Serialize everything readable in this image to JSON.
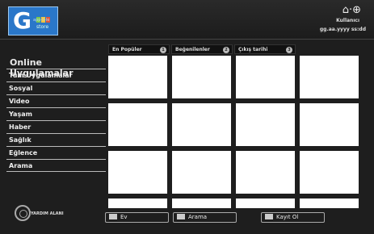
{
  "header": {
    "logo_letter": "G",
    "logo_line1": "app-li-le",
    "logo_line2": "store",
    "top_icons": "⌂·⊕",
    "user_label": "Kullanıcı",
    "datetime": "gg.aa.yyyy ss:dd"
  },
  "sidebar": {
    "title": "Online Uygulamalar",
    "items": [
      "Tüm Uygulamalar",
      "Sosyal",
      "Video",
      "Yaşam",
      "Haber",
      "Sağlık",
      "Eğlence",
      "Arama"
    ]
  },
  "tabs": [
    {
      "label": "En Popüler",
      "num": "1"
    },
    {
      "label": "Beğenilenler",
      "num": "2"
    },
    {
      "label": "Çıkış tarihi",
      "num": "3"
    }
  ],
  "help_label": "YARDIM ALANI",
  "bottom_buttons": [
    "Ev",
    "Arama",
    "Kayıt Ol"
  ],
  "colors": {
    "logo_blue": "#2a77c9",
    "background": "#1e1e1e"
  }
}
